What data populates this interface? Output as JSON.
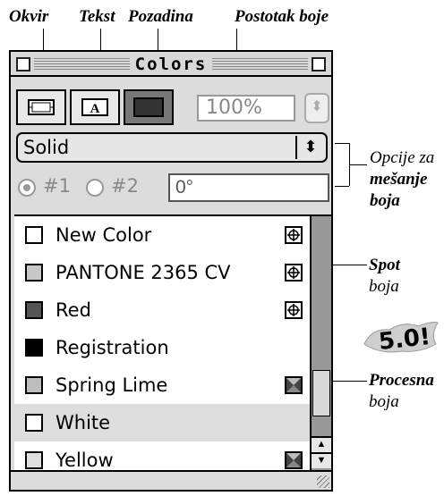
{
  "callouts": {
    "frame": "Okvir",
    "text": "Tekst",
    "background": "Pozadina",
    "shade_percent": "Postotak boje",
    "blend_line1": "Opcije za",
    "blend_line2": "mešanje",
    "blend_line3": "boja",
    "spot_line1": "Spot",
    "spot_line2": "boja",
    "process_line1": "Procesna",
    "process_line2": "boja",
    "version_badge": "5.0!"
  },
  "palette": {
    "title": "Colors",
    "shade_value": "100%",
    "blend_style": "Solid",
    "radio1_label": "#1",
    "radio2_label": "#2",
    "angle_value": "0°",
    "items": [
      {
        "name": "New Color",
        "swatch": "#ffffff",
        "type": "spot"
      },
      {
        "name": "PANTONE 2365 CV",
        "swatch": "#c8c8c8",
        "type": "spot"
      },
      {
        "name": "Red",
        "swatch": "#555555",
        "type": "spot"
      },
      {
        "name": "Registration",
        "swatch": "#000000",
        "type": "none"
      },
      {
        "name": "Spring Lime",
        "swatch": "#bdbdbd",
        "type": "process"
      },
      {
        "name": "White",
        "swatch": "#ffffff",
        "type": "none"
      },
      {
        "name": "Yellow",
        "swatch": "#e0e0e0",
        "type": "process"
      }
    ]
  }
}
